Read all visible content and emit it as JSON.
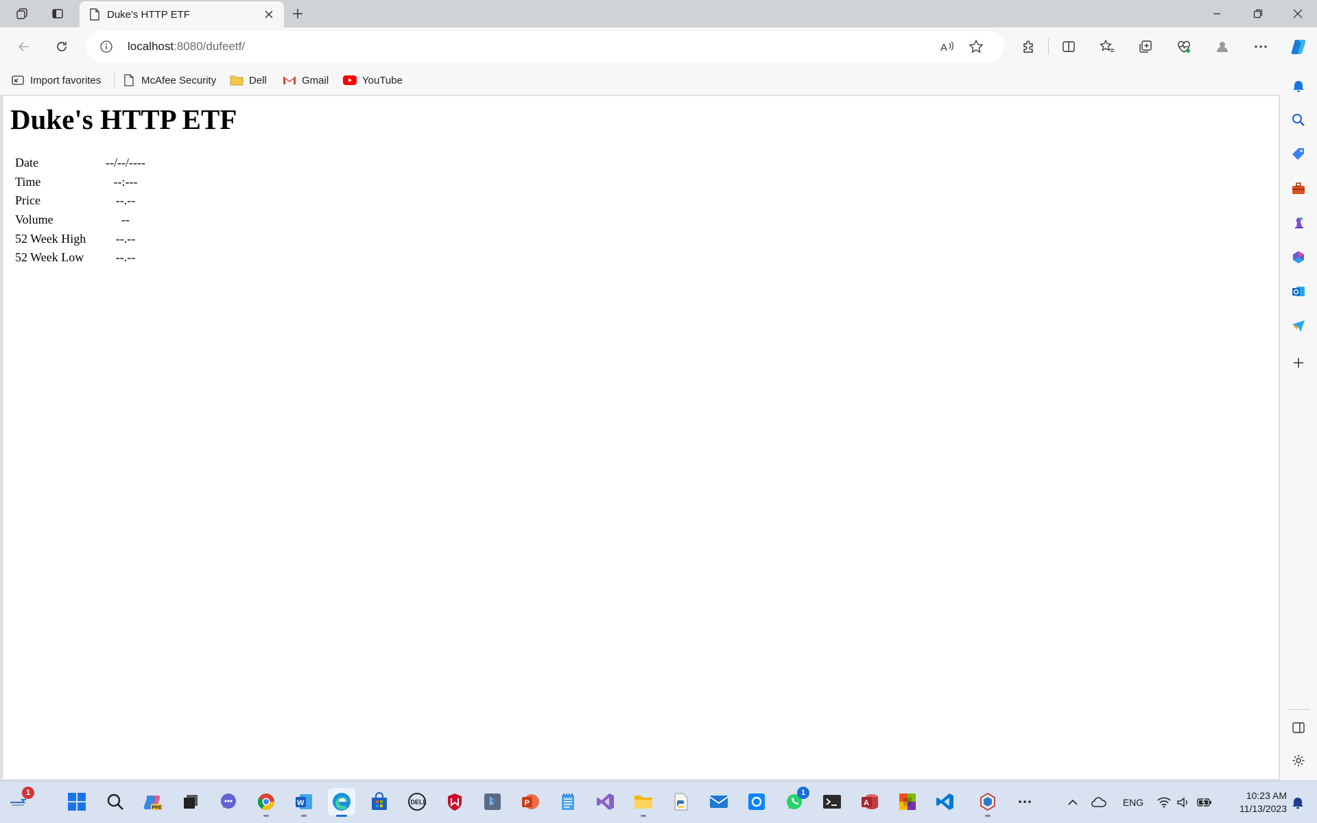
{
  "browser": {
    "tab": {
      "title": "Duke's HTTP ETF"
    },
    "address": {
      "host": "localhost",
      "path": ":8080/dufeetf/"
    },
    "favorites": [
      {
        "label": "Import favorites",
        "icon": "import-favorites-icon"
      },
      {
        "label": "McAfee Security",
        "icon": "page-icon"
      },
      {
        "label": "Dell",
        "icon": "folder-icon"
      },
      {
        "label": "Gmail",
        "icon": "gmail-icon"
      },
      {
        "label": "YouTube",
        "icon": "youtube-icon"
      }
    ]
  },
  "page": {
    "heading": "Duke's HTTP ETF",
    "rows": [
      {
        "label": "Date",
        "value": "--/--/----"
      },
      {
        "label": "Time",
        "value": "--:---"
      },
      {
        "label": "Price",
        "value": "--.--"
      },
      {
        "label": "Volume",
        "value": "--"
      },
      {
        "label": "52 Week High",
        "value": "--.--"
      },
      {
        "label": "52 Week Low",
        "value": "--.--"
      }
    ]
  },
  "taskbar": {
    "badges": {
      "widgets": "1",
      "whatsapp": "1"
    },
    "tray": {
      "language": "ENG"
    },
    "clock": {
      "time": "10:23 AM",
      "date": "11/13/2023"
    }
  },
  "colors": {
    "accent": "#1b6ed6",
    "youtube": "#ff0000",
    "gmail": "#ea4335",
    "folder": "#f2c94c"
  }
}
